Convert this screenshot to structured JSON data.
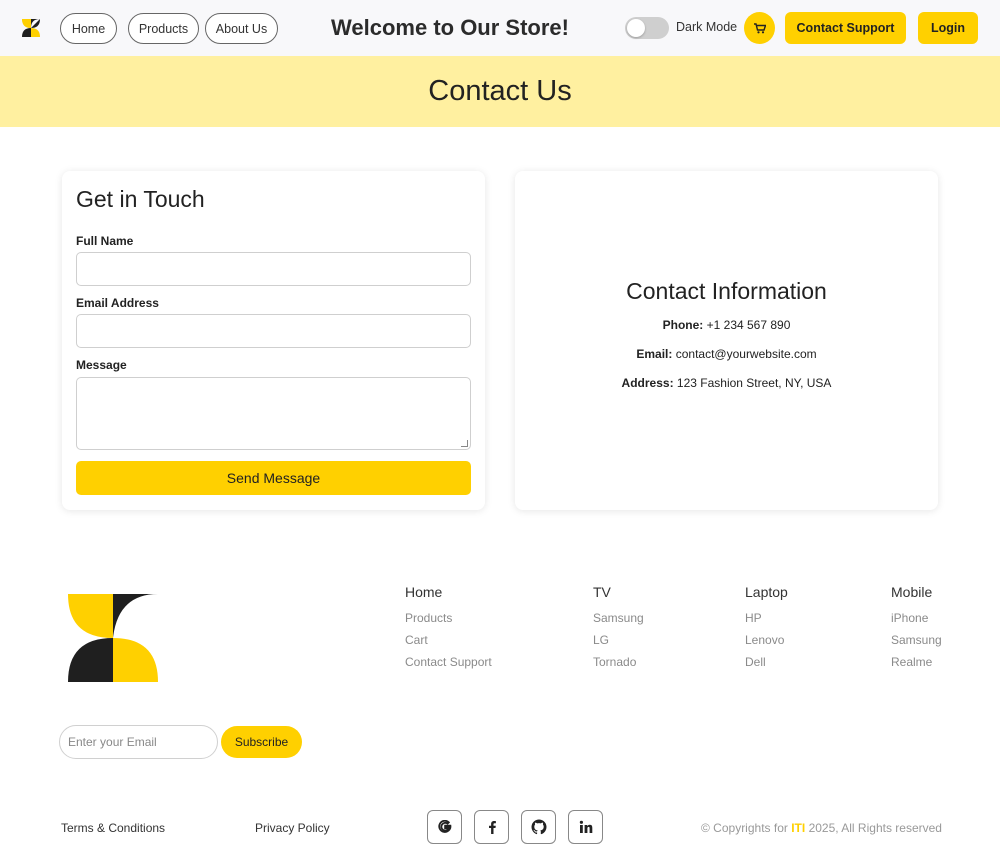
{
  "nav": {
    "links": [
      "Home",
      "Products",
      "About Us"
    ],
    "title": "Welcome to Our Store!",
    "dark_mode_label": "Dark Mode",
    "dark_mode_on": false,
    "contact_support_label": "Contact Support",
    "login_label": "Login"
  },
  "banner": {
    "title": "Contact Us"
  },
  "form": {
    "title": "Get in Touch",
    "name_label": "Full Name",
    "name_value": "",
    "email_label": "Email Address",
    "email_value": "",
    "message_label": "Message",
    "message_value": "",
    "submit_label": "Send Message"
  },
  "contact_info": {
    "title": "Contact Information",
    "phone_label": "Phone:",
    "phone_value": "+1 234 567 890",
    "email_label": "Email:",
    "email_value": "contact@yourwebsite.com",
    "address_label": "Address:",
    "address_value": "123 Fashion Street, NY, USA"
  },
  "footer": {
    "columns": [
      {
        "heading": "Home",
        "links": [
          "Products",
          "Cart",
          "Contact Support"
        ]
      },
      {
        "heading": "TV",
        "links": [
          "Samsung",
          "LG",
          "Tornado"
        ]
      },
      {
        "heading": "Laptop",
        "links": [
          "HP",
          "Lenovo",
          "Dell"
        ]
      },
      {
        "heading": "Mobile",
        "links": [
          "iPhone",
          "Samsung",
          "Realme"
        ]
      }
    ],
    "subscribe_placeholder": "Enter your Email",
    "subscribe_label": "Subscribe",
    "terms_label": "Terms & Conditions",
    "privacy_label": "Privacy Policy",
    "social_icons": [
      "google-icon",
      "facebook-icon",
      "github-icon",
      "linkedin-icon"
    ],
    "copyright_prefix": "© Copyrights for",
    "copyright_brand": "ITI",
    "copyright_suffix": "2025, All Rights reserved"
  },
  "colors": {
    "accent": "#ffd000",
    "banner": "#fff0a0",
    "dark": "#1f1f1f"
  }
}
